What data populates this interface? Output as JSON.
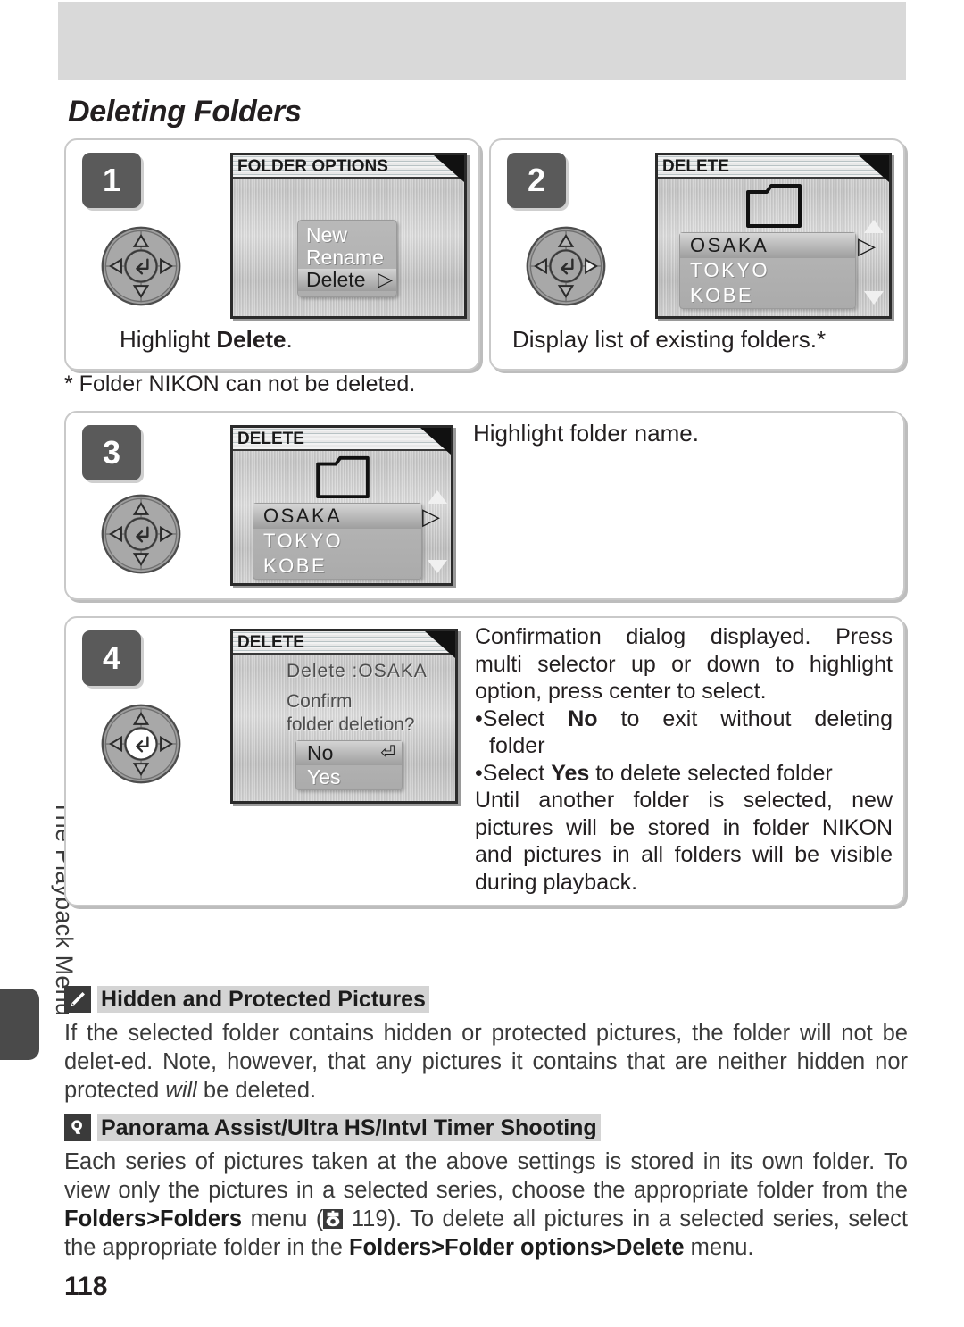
{
  "page": {
    "title": "Deleting Folders",
    "number": "118",
    "side_tab_label": "The Playback Menu",
    "footnote": "* Folder NIKON can not be deleted."
  },
  "steps": [
    {
      "number": "1",
      "caption_prefix": "Highlight ",
      "caption_bold": "Delete",
      "caption_suffix": ".",
      "lcd": {
        "title": "FOLDER OPTIONS",
        "menu_items": [
          {
            "label": "New",
            "selected": false
          },
          {
            "label": "Rename",
            "selected": false
          },
          {
            "label": "Delete",
            "selected": true
          }
        ]
      }
    },
    {
      "number": "2",
      "caption": "Display list of existing folders.*",
      "lcd": {
        "title": "DELETE",
        "folders": [
          {
            "label": "OSAKA",
            "selected": true
          },
          {
            "label": "TOKYO",
            "selected": false
          },
          {
            "label": "KOBE",
            "selected": false
          }
        ]
      }
    },
    {
      "number": "3",
      "caption": "Highlight folder name.",
      "lcd": {
        "title": "DELETE",
        "folders": [
          {
            "label": "OSAKA",
            "selected": true
          },
          {
            "label": "TOKYO",
            "selected": false
          },
          {
            "label": "KOBE",
            "selected": false
          }
        ]
      }
    },
    {
      "number": "4",
      "lcd": {
        "title": "DELETE",
        "line_target": "Delete :OSAKA",
        "line_confirm_1": "Confirm",
        "line_confirm_2": "folder deletion?",
        "options": [
          {
            "label": "No",
            "selected": true
          },
          {
            "label": "Yes",
            "selected": false
          }
        ]
      },
      "body": {
        "p1_l1": "Confirmation dialog displayed.   Press",
        "p1_l2": "multi selector up or down to highlight",
        "p1_l3": "option, press center to select.",
        "b1_pre": "Select ",
        "b1_bold": "No",
        "b1_post": " to exit without deleting",
        "b1_cont": "folder",
        "b2_pre": "Select ",
        "b2_bold": "Yes",
        "b2_post": " to delete selected folder",
        "p2_l1": "Until another folder is selected, new",
        "p2_l2": "pictures will be stored in folder NIKON",
        "p2_l3": "and pictures in all folders will be visible",
        "p2_l4": "during playback."
      }
    }
  ],
  "notes": [
    {
      "icon": "pencil-icon",
      "title": "Hidden and Protected Pictures",
      "body_1": "If the selected folder contains hidden or protected pictures, the folder will not be delet-ed.  Note, however, that any pictures it contains that are neither hidden nor protected ",
      "body_italic": "will",
      "body_2": " be deleted."
    },
    {
      "icon": "lightbulb-icon",
      "title": "Panorama Assist/Ultra HS/Intvl Timer Shooting",
      "seg_1": "Each series of pictures taken at the above settings is stored in its own folder.  To view only the pictures in a selected series, choose the appropriate folder from the ",
      "bold_1": "Folders",
      "gt_1": ">",
      "bold_2": "Folders",
      "seg_2": " menu (",
      "page_ref": " 119).  To delete all pictures in a selected series, select the appropriate folder in the ",
      "bold_3": "Folders",
      "gt_2": ">",
      "bold_4": "Folder options",
      "gt_3": ">",
      "bold_5": "Delete",
      "seg_3": " menu."
    }
  ],
  "colors": {
    "header_bar": "#d9d9d9",
    "badge": "#5a5a5a",
    "panel_border": "#c9c9c9",
    "note_icon": "#3a3a3a",
    "note_title_bg": "#d4d4d4"
  }
}
